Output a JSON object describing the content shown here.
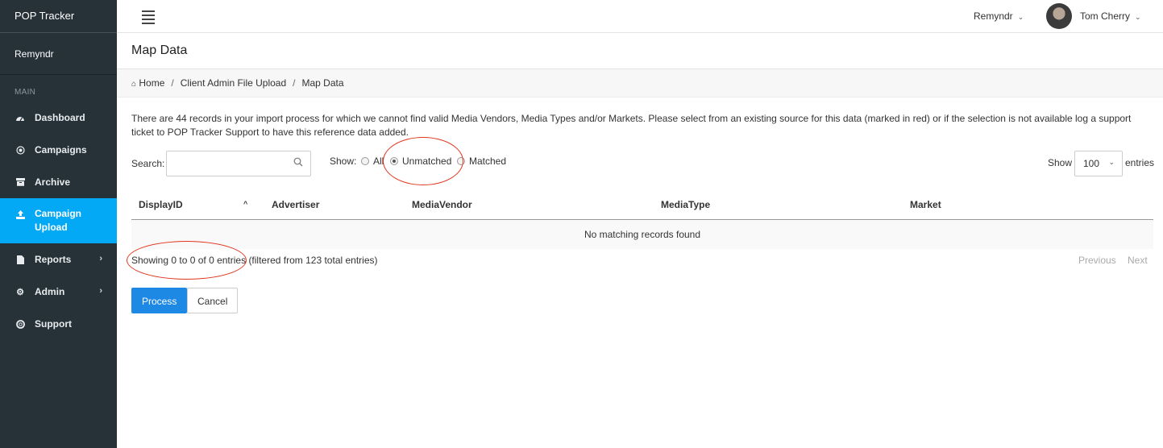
{
  "sidebar": {
    "brand": "POP Tracker",
    "org": "Remyndr",
    "section": "MAIN",
    "items": [
      {
        "label": "Dashboard",
        "icon": "dashboard-icon"
      },
      {
        "label": "Campaigns",
        "icon": "target-icon"
      },
      {
        "label": "Archive",
        "icon": "archive-icon"
      },
      {
        "label": "Campaign Upload",
        "icon": "upload-icon",
        "active": true
      },
      {
        "label": "Reports",
        "icon": "file-icon",
        "has_submenu": true
      },
      {
        "label": "Admin",
        "icon": "gear-icon",
        "has_submenu": true
      },
      {
        "label": "Support",
        "icon": "lifebuoy-icon"
      }
    ]
  },
  "header": {
    "org_switch": "Remyndr",
    "user_name": "Tom Cherry"
  },
  "page": {
    "title": "Map Data",
    "breadcrumb": [
      "Home",
      "Client Admin File Upload",
      "Map Data"
    ]
  },
  "notice": "There are 44 records in your import process for which we cannot find valid Media Vendors, Media Types and/or Markets. Please select from an existing source for this data (marked in red) or if the selection is not available log a support ticket to POP Tracker Support to have this reference data added.",
  "filters": {
    "search_label": "Search:",
    "search_value": "",
    "show_label": "Show:",
    "options": [
      "All",
      "Unmatched",
      "Matched"
    ],
    "selected": "Unmatched",
    "length_label": "Show",
    "length_value": "100",
    "entries_label": "entries"
  },
  "table": {
    "columns": [
      "DisplayID",
      "Advertiser",
      "MediaVendor",
      "MediaType",
      "Market"
    ],
    "empty_message": "No matching records found",
    "info": "Showing 0 to 0 of 0 entries",
    "info_filtered": "(filtered from 123 total entries)",
    "prev_label": "Previous",
    "next_label": "Next"
  },
  "actions": {
    "process_label": "Process",
    "cancel_label": "Cancel"
  },
  "colors": {
    "sidebar_bg": "#263238",
    "active_item": "#03a9f4",
    "primary_button": "#1e88e5",
    "annotation": "#e1341e"
  }
}
